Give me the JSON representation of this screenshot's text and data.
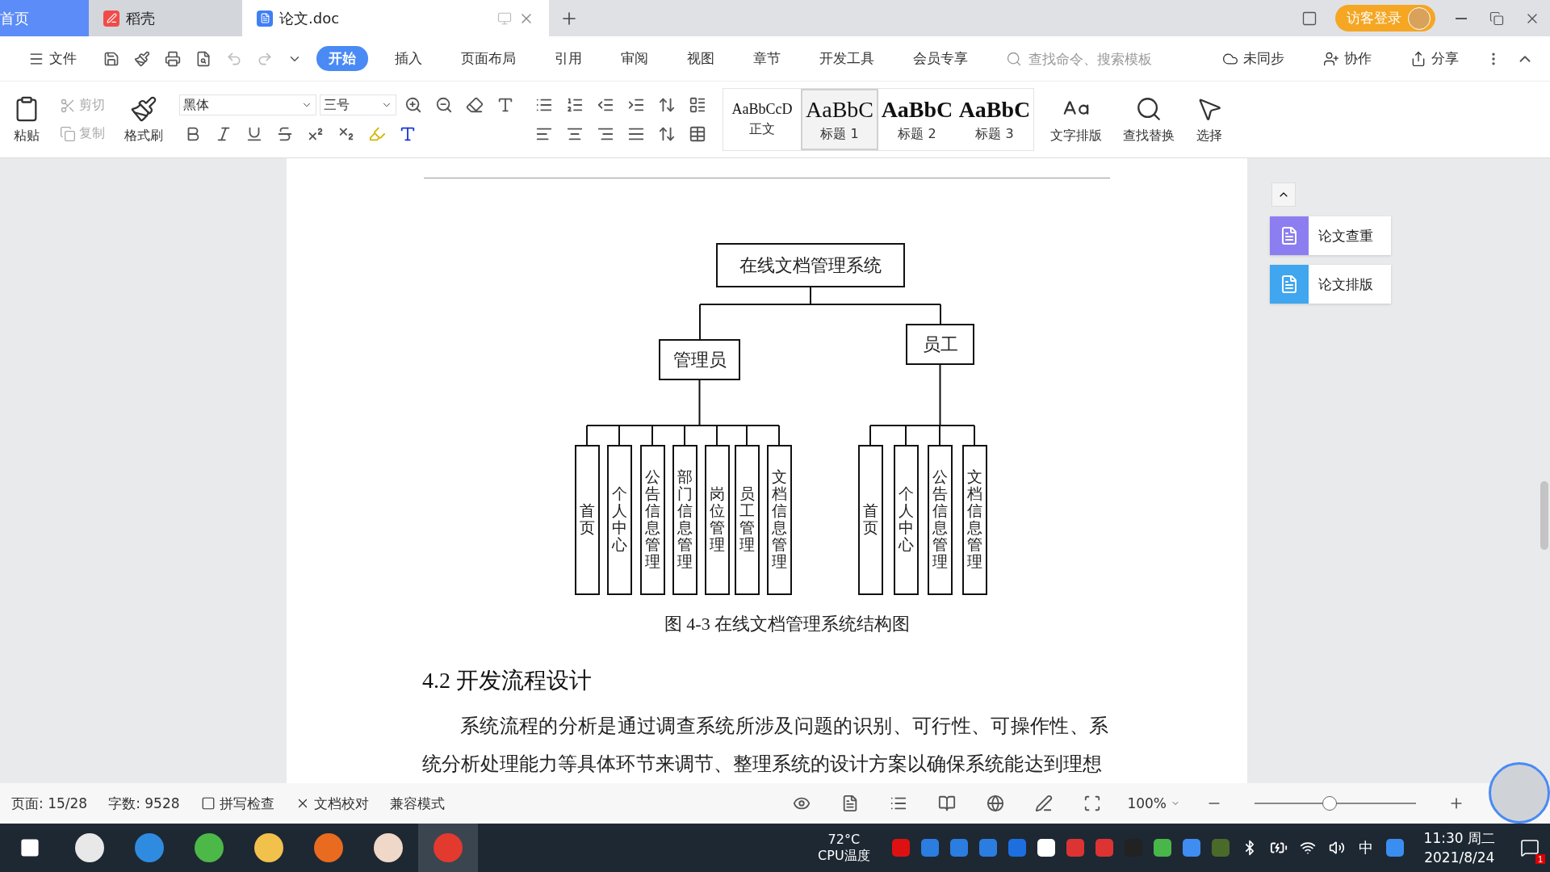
{
  "tabs": [
    {
      "label": "首页",
      "kind": "home",
      "selected": false
    },
    {
      "label": "稻壳",
      "kind": "app",
      "selected": false
    },
    {
      "label": "论文.doc",
      "kind": "doc",
      "selected": true
    }
  ],
  "account": {
    "label": "访客登录"
  },
  "menu": {
    "file": "文件",
    "tabs": [
      {
        "label": "开始",
        "selected": true
      },
      {
        "label": "插入",
        "selected": false
      },
      {
        "label": "页面布局",
        "selected": false
      },
      {
        "label": "引用",
        "selected": false
      },
      {
        "label": "审阅",
        "selected": false
      },
      {
        "label": "视图",
        "selected": false
      },
      {
        "label": "章节",
        "selected": false
      },
      {
        "label": "开发工具",
        "selected": false
      },
      {
        "label": "会员专享",
        "selected": false
      }
    ],
    "search": {
      "placeholder": "查找命令、搜索模板"
    },
    "actions": [
      {
        "label": "未同步",
        "kind": "sync"
      },
      {
        "label": "协作",
        "kind": "collab"
      },
      {
        "label": "分享",
        "kind": "share"
      }
    ]
  },
  "ribbon": {
    "paste": "粘贴",
    "cut": {
      "label": "剪切",
      "disabled": true
    },
    "copy": {
      "label": "复制",
      "disabled": true
    },
    "format_painter": "格式刷",
    "font": "黑体",
    "size": "三号",
    "styles": [
      {
        "preview": "AaBbCcD",
        "label": "正文",
        "kind": "body",
        "selected": false
      },
      {
        "preview": "AaBbC",
        "label": "标题 1",
        "kind": "h1",
        "selected": true
      },
      {
        "preview": "AaBbC",
        "label": "标题 2",
        "kind": "h2",
        "selected": false
      },
      {
        "preview": "AaBbC",
        "label": "标题 3",
        "kind": "h3",
        "selected": false
      }
    ],
    "tools": [
      {
        "label": "文字排版",
        "kind": "layout"
      },
      {
        "label": "查找替换",
        "kind": "find"
      },
      {
        "label": "选择",
        "kind": "select"
      }
    ]
  },
  "document": {
    "diagram": {
      "root": "在线文档管理系统",
      "branches": [
        {
          "label": "管理员",
          "children": [
            "首页",
            "个人中心",
            "公告信息管理",
            "部门信息管理",
            "岗位管理",
            "员工管理",
            "文档信息管理"
          ]
        },
        {
          "label": "员工",
          "children": [
            "首页",
            "个人中心",
            "公告信息管理",
            "文档信息管理"
          ]
        }
      ]
    },
    "caption": "图 4-3  在线文档管理系统结构图",
    "heading": "4.2 开发流程设计",
    "paragraph": "系统流程的分析是通过调查系统所涉及问题的识别、可行性、可操作性、系统分析处理能力等具体环节来调节、整理系统的设计方案以确保系统能达到理想"
  },
  "side_panel": [
    "论文查重",
    "论文排版"
  ],
  "status_bar": {
    "page": "页面: 15/28",
    "words": "字数: 9528",
    "tools": [
      {
        "label": "拼写检查",
        "kind": "check"
      },
      {
        "label": "文档校对",
        "kind": "proof"
      },
      {
        "label": "兼容模式",
        "kind": "plain"
      }
    ],
    "zoom": "100%",
    "zoom_slider": {
      "level": 0.46
    }
  },
  "taskbar": {
    "temperature": "72°C",
    "sensor": "CPU温度",
    "ime": "中",
    "time": "11:30 周二",
    "date": "2021/8/24",
    "badge": "1"
  }
}
